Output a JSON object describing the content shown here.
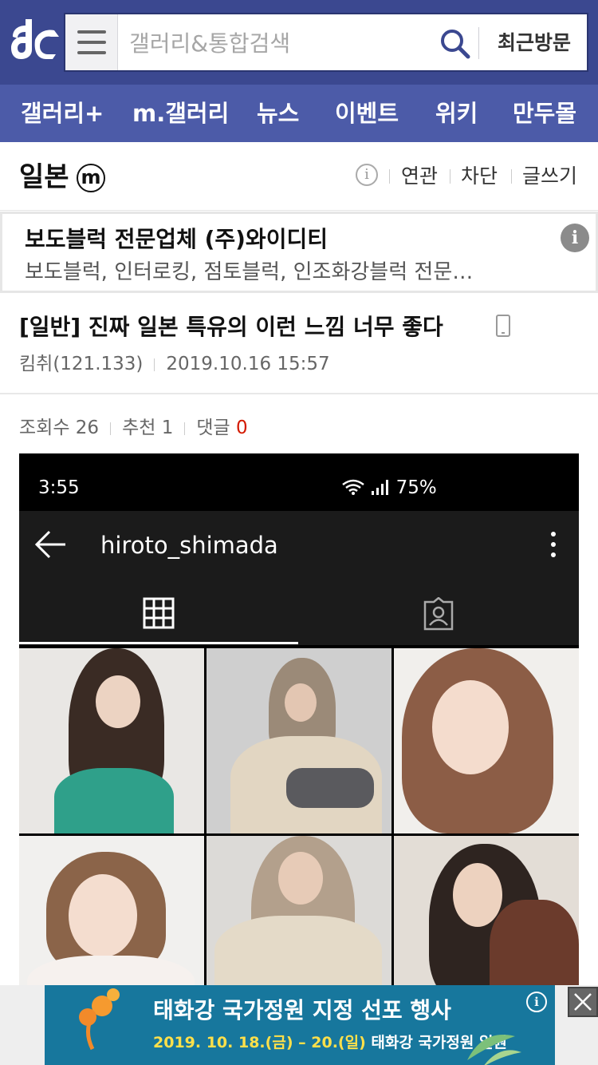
{
  "header": {
    "search_placeholder": "갤러리&통합검색",
    "recent_label": "최근방문"
  },
  "nav": {
    "items": [
      "갤러리+",
      "m.갤러리",
      "뉴스",
      "이벤트",
      "위키",
      "만두몰"
    ]
  },
  "gallery": {
    "title": "일본",
    "minor_badge": "m",
    "links": [
      "연관",
      "차단",
      "글쓰기"
    ]
  },
  "ad": {
    "title": "보도블럭 전문업체 (주)와이디티",
    "description": "보도블럭, 인터로킹, 점토블럭, 인조화강블럭 전문…"
  },
  "post": {
    "title": "[일반] 진짜 일본 특유의 이런 느낌 너무 좋다",
    "author": "킴취(121.133)",
    "date": "2019.10.16 15:57",
    "views_label": "조회수 26",
    "recommend_label": "추천 1",
    "comment_label": "댓글",
    "comment_count": "0"
  },
  "screenshot": {
    "time": "3:55",
    "battery": "75%",
    "username": "hiroto_shimada"
  },
  "banner": {
    "main": "태화강 국가정원 지정 선포 행사",
    "date_a": "2019. 10. 18.",
    "day_a": "(금)",
    "dash": " – ",
    "date_b": "20.",
    "day_b": "(일)",
    "place": "태화강 국가정원 일원"
  },
  "colors": {
    "header_bg": "#3b4890",
    "nav_bg": "#4c5ba8",
    "comment_count": "#d31900",
    "banner_bg": "#17779d"
  }
}
